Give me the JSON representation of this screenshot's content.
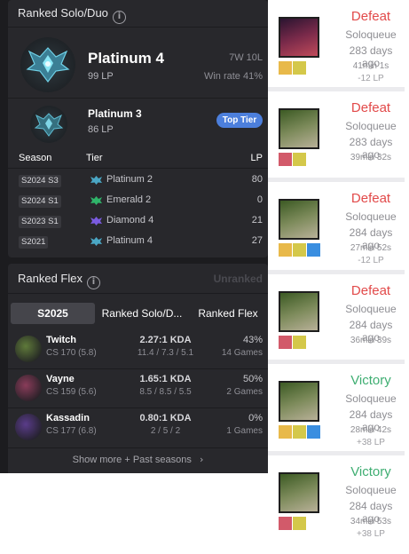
{
  "ranked_solo": {
    "title": "Ranked Solo/Duo",
    "current": {
      "tier": "Platinum 4",
      "lp": "99 LP",
      "record": "7W 10L",
      "winrate": "Win rate 41%"
    },
    "peak": {
      "tier": "Platinum 3",
      "lp": "86 LP",
      "badge": "Top Tier"
    },
    "table_headers": [
      "Season",
      "Tier",
      "LP"
    ],
    "seasons": [
      {
        "season": "S2024 S3",
        "tier": "Platinum 2",
        "lp": "80",
        "color": "#4aa6c4"
      },
      {
        "season": "S2024 S1",
        "tier": "Emerald 2",
        "lp": "0",
        "color": "#2fb46a"
      },
      {
        "season": "S2023 S1",
        "tier": "Diamond 4",
        "lp": "21",
        "color": "#7a5be0"
      },
      {
        "season": "S2021",
        "tier": "Platinum 4",
        "lp": "27",
        "color": "#4aa6c4"
      }
    ]
  },
  "ranked_flex": {
    "title": "Ranked Flex",
    "status": "Unranked"
  },
  "champ_tabs": [
    "S2025",
    "Ranked Solo/D...",
    "Ranked Flex"
  ],
  "champions": [
    {
      "name": "Twitch",
      "cs": "CS 170 (5.8)",
      "kda": "2.27:1 KDA",
      "kda_detail": "11.4 / 7.3 / 5.1",
      "winrate": "43%",
      "games": "14 Games",
      "color": "#5f7a3a"
    },
    {
      "name": "Vayne",
      "cs": "CS 159 (5.6)",
      "kda": "1.65:1 KDA",
      "kda_detail": "8.5 / 8.5 / 5.5",
      "winrate": "50%",
      "games": "2 Games",
      "color": "#8a3c5a"
    },
    {
      "name": "Kassadin",
      "cs": "CS 177 (6.8)",
      "kda": "0.80:1 KDA",
      "kda_detail": "2 / 5 / 2",
      "winrate": "0%",
      "games": "1 Games",
      "color": "#5a3c8a"
    }
  ],
  "show_more": "Show more + Past seasons",
  "colors": {
    "defeat": "#e24a4a",
    "victory": "#3fae72",
    "accent": "#4c7fdc"
  },
  "matches": [
    {
      "result": "Defeat",
      "queue": "Soloqueue",
      "date": "283 days ago",
      "duration": "41min 1s",
      "lp": "-12 LP",
      "champion": "vayne",
      "spells": [
        "teleport-spell-icon",
        "smite-spell-icon"
      ]
    },
    {
      "result": "Defeat",
      "queue": "Soloqueue",
      "date": "283 days ago",
      "duration": "39min 32s",
      "lp": "",
      "champion": "twitch",
      "spells": [
        "cleanse-spell-icon",
        "smite-spell-icon"
      ]
    },
    {
      "result": "Defeat",
      "queue": "Soloqueue",
      "date": "284 days ago",
      "duration": "27min 52s",
      "lp": "-12 LP",
      "champion": "twitch",
      "spells": [
        "teleport-spell-icon",
        "smite-spell-icon",
        "flash-spell-icon"
      ]
    },
    {
      "result": "Defeat",
      "queue": "Soloqueue",
      "date": "284 days ago",
      "duration": "36min 39s",
      "lp": "",
      "champion": "twitch",
      "spells": [
        "cleanse-spell-icon",
        "smite-spell-icon"
      ]
    },
    {
      "result": "Victory",
      "queue": "Soloqueue",
      "date": "284 days ago",
      "duration": "28min 42s",
      "lp": "+38 LP",
      "champion": "twitch",
      "spells": [
        "teleport-spell-icon",
        "smite-spell-icon",
        "flash-spell-icon"
      ]
    },
    {
      "result": "Victory",
      "queue": "Soloqueue",
      "date": "284 days ago",
      "duration": "34min 53s",
      "lp": "+38 LP",
      "champion": "twitch",
      "spells": [
        "cleanse-spell-icon",
        "smite-spell-icon"
      ]
    }
  ]
}
